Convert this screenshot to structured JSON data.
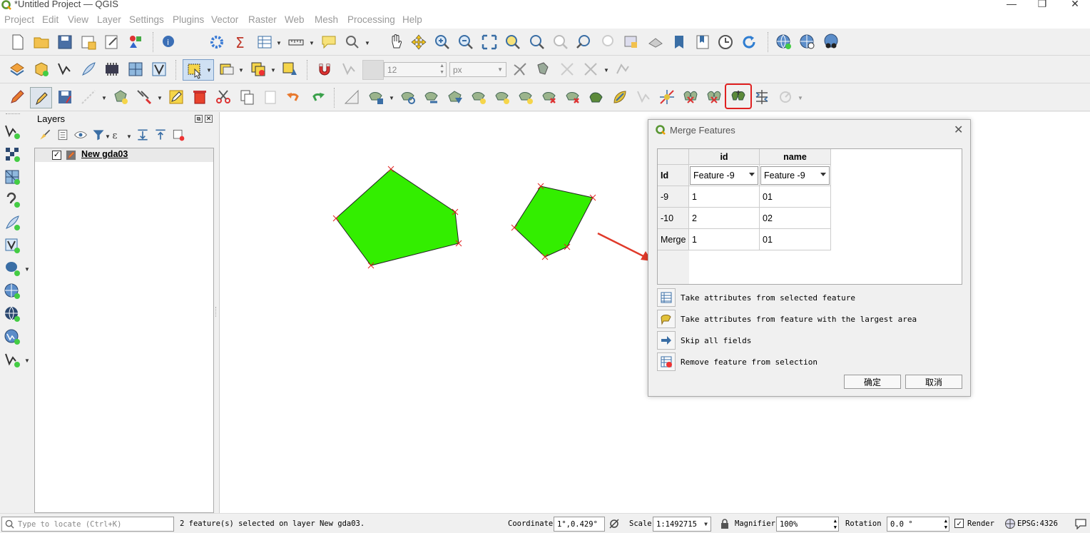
{
  "window": {
    "title": "*Untitled Project — QGIS"
  },
  "menubar": {
    "items": [
      "Project",
      "Edit",
      "View",
      "Layer",
      "Settings",
      "Plugins",
      "Vector",
      "Raster",
      "Web",
      "Mesh",
      "Processing",
      "Help"
    ]
  },
  "snapping": {
    "tolerance": "12",
    "unit": "px"
  },
  "layers_panel": {
    "title": "Layers",
    "layer": {
      "name": "New gda03",
      "checked": true
    }
  },
  "merge_dialog": {
    "title": "Merge Features",
    "columns": [
      "id",
      "name"
    ],
    "rows": [
      {
        "header": "Id",
        "values": [
          "Feature -9",
          "Feature -9"
        ],
        "combo": true
      },
      {
        "header": "-9",
        "values": [
          "1",
          "01"
        ]
      },
      {
        "header": "-10",
        "values": [
          "2",
          "02"
        ]
      },
      {
        "header": "Merge",
        "values": [
          "1",
          "01"
        ]
      }
    ],
    "actions": [
      {
        "label": "Take attributes from selected feature",
        "icon": "table-icon"
      },
      {
        "label": "Take attributes from feature with the largest area",
        "icon": "largest-area-icon"
      },
      {
        "label": "Skip all fields",
        "icon": "arrow-right-icon"
      },
      {
        "label": "Remove feature from selection",
        "icon": "remove-selection-icon"
      }
    ],
    "ok_label": "确定",
    "cancel_label": "取消"
  },
  "statusbar": {
    "locate_placeholder": "Type to locate (Ctrl+K)",
    "message": "2 feature(s) selected on layer New gda03.",
    "coordinate_label": "Coordinate",
    "coordinate_value": "1°,0.429°",
    "scale_label": "Scale",
    "scale_value": "1:1492715",
    "magnifier_label": "Magnifier",
    "magnifier_value": "100%",
    "rotation_label": "Rotation",
    "rotation_value": "0.0 °",
    "render_label": "Render",
    "crs": "EPSG:4326"
  },
  "colors": {
    "polygon_fill": "#33ee00",
    "highlight": "#e02020",
    "arrow": "#e03a2a"
  }
}
